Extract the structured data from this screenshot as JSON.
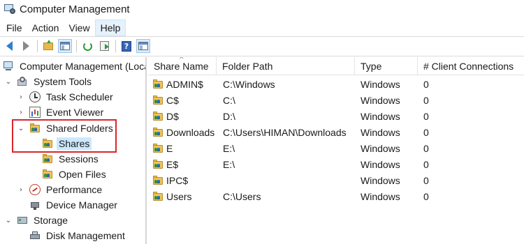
{
  "window": {
    "title": "Computer Management"
  },
  "menu": [
    "File",
    "Action",
    "View",
    "Help"
  ],
  "toolbar": {
    "icons": [
      "back-arrow-icon",
      "forward-arrow-icon",
      "up-folder-icon",
      "show-hide-console-tree-icon",
      "refresh-icon",
      "export-list-icon",
      "help-icon",
      "properties-view-icon"
    ],
    "help_glyph": "?"
  },
  "tree": {
    "root": "Computer Management (Local)",
    "system_tools": "System Tools",
    "task_scheduler": "Task Scheduler",
    "event_viewer": "Event Viewer",
    "shared_folders": "Shared Folders",
    "shares": "Shares",
    "sessions": "Sessions",
    "open_files": "Open Files",
    "performance": "Performance",
    "device_manager": "Device Manager",
    "storage": "Storage",
    "disk_management": "Disk Management"
  },
  "columns": [
    "Share Name",
    "Folder Path",
    "Type",
    "# Client Connections"
  ],
  "shares": [
    {
      "name": "ADMIN$",
      "path": "C:\\Windows",
      "type": "Windows",
      "connections": "0"
    },
    {
      "name": "C$",
      "path": "C:\\",
      "type": "Windows",
      "connections": "0"
    },
    {
      "name": "D$",
      "path": "D:\\",
      "type": "Windows",
      "connections": "0"
    },
    {
      "name": "Downloads",
      "path": "C:\\Users\\HIMAN\\Downloads",
      "type": "Windows",
      "connections": "0"
    },
    {
      "name": "E",
      "path": "E:\\",
      "type": "Windows",
      "connections": "0"
    },
    {
      "name": "E$",
      "path": "E:\\",
      "type": "Windows",
      "connections": "0"
    },
    {
      "name": "IPC$",
      "path": "",
      "type": "Windows",
      "connections": "0"
    },
    {
      "name": "Users",
      "path": "C:\\Users",
      "type": "Windows",
      "connections": "0"
    }
  ],
  "colors": {
    "selection": "#cce8ff",
    "highlight_box": "#d9252b",
    "menu_active": "#e5f1fb"
  }
}
